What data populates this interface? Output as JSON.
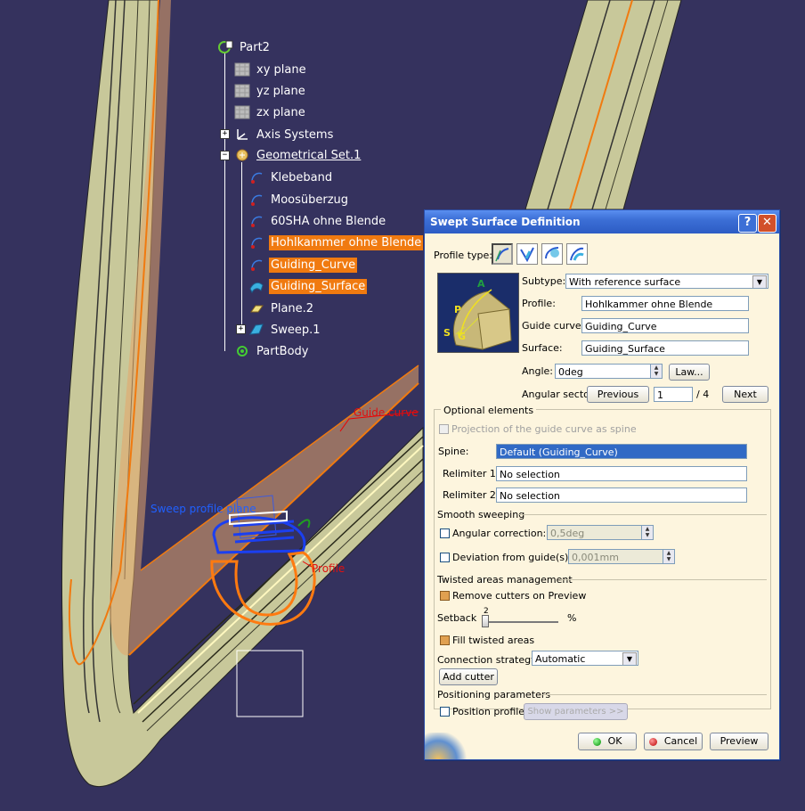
{
  "colors": {
    "background": "#35325e",
    "selection": "#f07a10",
    "dialog_bg": "#fdf5de",
    "titlebar": "#3c6fd6"
  },
  "tree": {
    "root": "Part2",
    "items": [
      {
        "label": "xy plane",
        "icon": "plane-icon"
      },
      {
        "label": "yz plane",
        "icon": "plane-icon"
      },
      {
        "label": "zx plane",
        "icon": "plane-icon"
      },
      {
        "label": "Axis Systems",
        "icon": "axis-system-icon"
      },
      {
        "label": "Geometrical Set.1",
        "icon": "geometrical-set-icon"
      },
      {
        "label": "Klebeband",
        "icon": "sketch-icon"
      },
      {
        "label": "Moosüberzug",
        "icon": "sketch-icon"
      },
      {
        "label": "60SHA ohne Blende",
        "icon": "sketch-icon"
      },
      {
        "label": "Hohlkammer ohne Blende",
        "icon": "sketch-icon",
        "selected": true
      },
      {
        "label": "Guiding_Curve",
        "icon": "sketch-icon",
        "selected": true
      },
      {
        "label": "Guiding_Surface",
        "icon": "surface-icon",
        "selected": true
      },
      {
        "label": "Plane.2",
        "icon": "plane-feature-icon"
      },
      {
        "label": "Sweep.1",
        "icon": "sweep-icon"
      },
      {
        "label": "PartBody",
        "icon": "part-body-icon"
      }
    ]
  },
  "viewport_labels": {
    "guide_curve": "Guide curve",
    "sweep_profile_plane": "Sweep profile plane",
    "profile": "Profile"
  },
  "dialog": {
    "title": "Swept Surface Definition",
    "help_button": "?",
    "close_button": "✕",
    "profile_type_label": "Profile type:",
    "profile_types": [
      "explicit",
      "line",
      "circle",
      "conic"
    ],
    "subtype_label": "Subtype:",
    "subtype_value": "With reference surface",
    "profile_label": "Profile:",
    "profile_value": "Hohlkammer ohne Blende",
    "guide_curve_label": "Guide curve:",
    "guide_curve_value": "Guiding_Curve",
    "surface_label": "Surface:",
    "surface_value": "Guiding_Surface",
    "angle_label": "Angle:",
    "angle_value": "0deg",
    "law_button": "Law...",
    "angular_sector_label": "Angular sector:",
    "previous_button": "Previous",
    "sector_value": "1",
    "sector_total": "/ 4",
    "next_button": "Next",
    "optional_elements": "Optional elements",
    "projection_label": "Projection of the guide curve as spine",
    "spine_label": "Spine:",
    "spine_value": "Default (Guiding_Curve)",
    "relimiter1_label": "Relimiter 1:",
    "relimiter1_value": "No selection",
    "relimiter2_label": "Relimiter 2:",
    "relimiter2_value": "No selection",
    "smooth_sweeping": "Smooth sweeping",
    "angular_correction_label": "Angular correction:",
    "angular_correction_value": "0,5deg",
    "deviation_label": "Deviation from guide(s):",
    "deviation_value": "0,001mm",
    "twisted_areas": "Twisted areas management",
    "remove_cutters_label": "Remove cutters on Preview",
    "setback_label": "Setback",
    "setback_value": "2",
    "setback_unit": "%",
    "fill_twisted_label": "Fill twisted areas",
    "connection_strategy_label": "Connection strategy:",
    "connection_strategy_value": "Automatic",
    "add_cutter_button": "Add cutter",
    "positioning_parameters": "Positioning parameters",
    "position_profile_label": "Position profile",
    "show_parameters_button": "Show parameters >>",
    "ok_button": "OK",
    "cancel_button": "Cancel",
    "preview_button": "Preview",
    "diagram_labels": {
      "a": "A",
      "p": "P",
      "s": "S",
      "g": "G"
    }
  }
}
